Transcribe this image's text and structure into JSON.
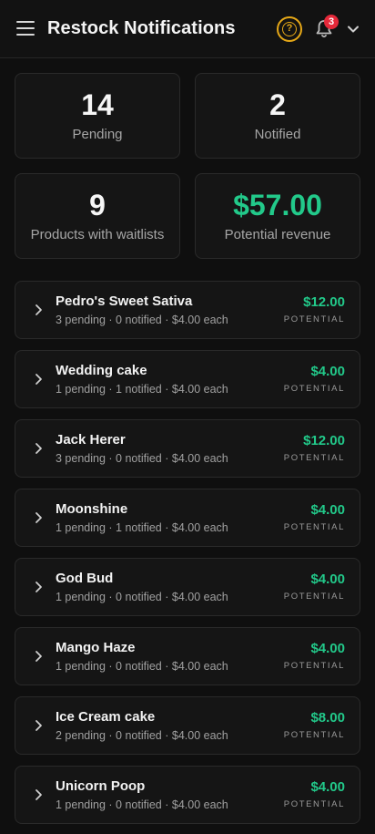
{
  "header": {
    "title": "Restock Notifications",
    "notification_count": "3",
    "help_icon_glyph": "?"
  },
  "stats": [
    {
      "value": "14",
      "label": "Pending"
    },
    {
      "value": "2",
      "label": "Notified"
    },
    {
      "value": "9",
      "label": "Products with waitlists"
    },
    {
      "value": "$57.00",
      "label": "Potential revenue"
    }
  ],
  "products": [
    {
      "name": "Pedro's Sweet Sativa",
      "meta": "3 pending · 0 notified · $4.00 each",
      "amount": "$12.00",
      "tag": "POTENTIAL"
    },
    {
      "name": "Wedding cake",
      "meta": "1 pending · 1 notified · $4.00 each",
      "amount": "$4.00",
      "tag": "POTENTIAL"
    },
    {
      "name": "Jack Herer",
      "meta": "3 pending · 0 notified · $4.00 each",
      "amount": "$12.00",
      "tag": "POTENTIAL"
    },
    {
      "name": "Moonshine",
      "meta": "1 pending · 1 notified · $4.00 each",
      "amount": "$4.00",
      "tag": "POTENTIAL"
    },
    {
      "name": "God Bud",
      "meta": "1 pending · 0 notified · $4.00 each",
      "amount": "$4.00",
      "tag": "POTENTIAL"
    },
    {
      "name": "Mango Haze",
      "meta": "1 pending · 0 notified · $4.00 each",
      "amount": "$4.00",
      "tag": "POTENTIAL"
    },
    {
      "name": "Ice Cream cake",
      "meta": "2 pending · 0 notified · $4.00 each",
      "amount": "$8.00",
      "tag": "POTENTIAL"
    },
    {
      "name": "Unicorn Poop",
      "meta": "1 pending · 0 notified · $4.00 each",
      "amount": "$4.00",
      "tag": "POTENTIAL"
    }
  ],
  "colors": {
    "background": "#0f0f0f",
    "card": "#151515",
    "accent_green": "#22c98a",
    "help_amber": "#e6a817",
    "badge_red": "#e5293a"
  }
}
